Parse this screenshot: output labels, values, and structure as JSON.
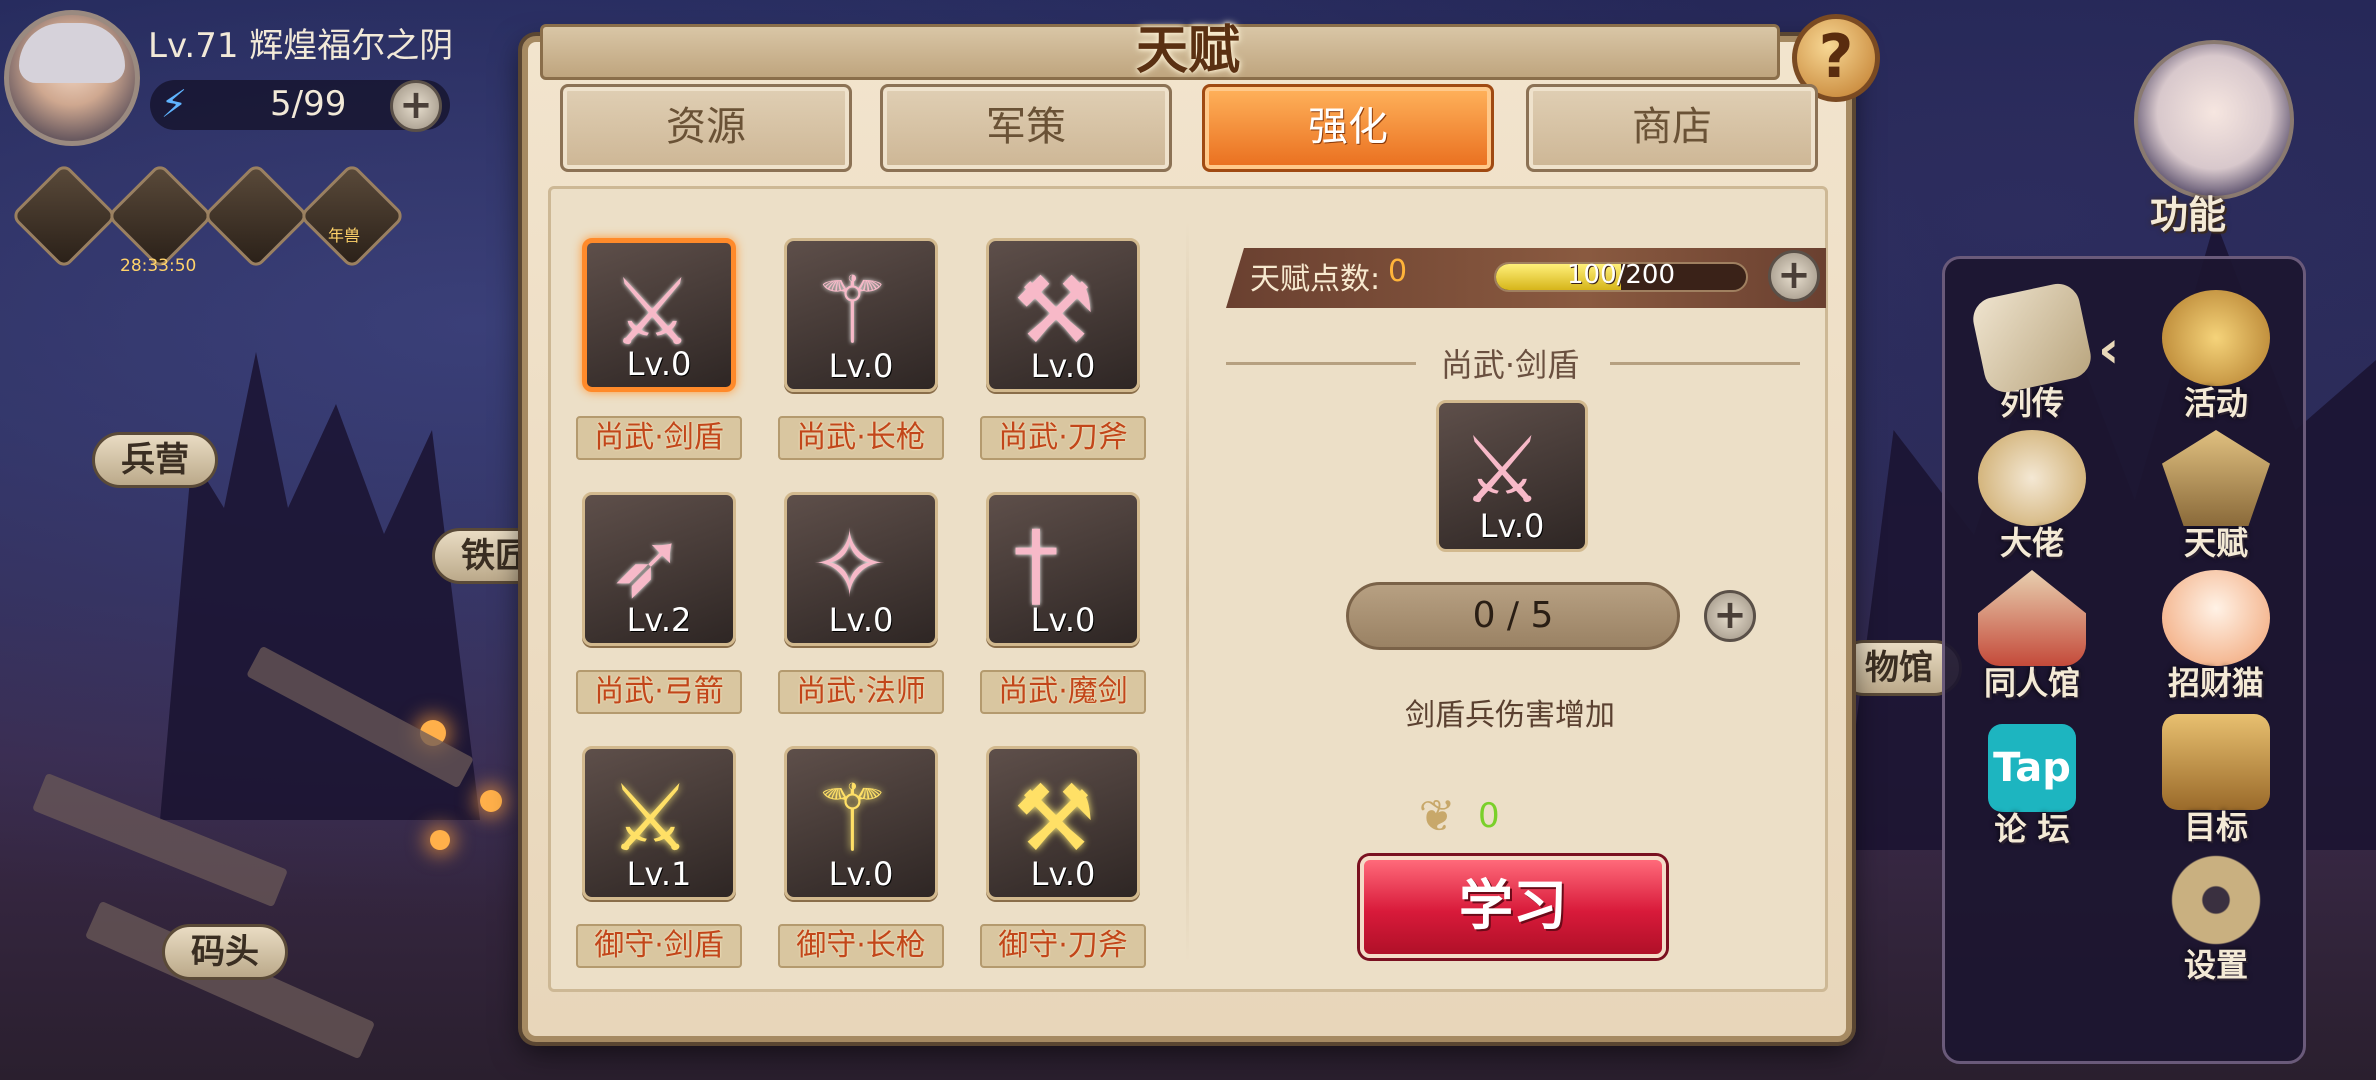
{
  "player": {
    "level_name": "Lv.71  辉煌福尔之阴",
    "energy": "5/99",
    "buff_timer": "28:33:50",
    "buff_label": "年兽"
  },
  "map_labels": {
    "barracks": "兵营",
    "ironworks": "铁匠",
    "dock": "码头",
    "museum": "物馆"
  },
  "side_menu": {
    "title": "功能",
    "items": [
      {
        "label": "列传",
        "icon": "scroll-icon"
      },
      {
        "label": "活动",
        "icon": "star-badge-icon"
      },
      {
        "label": "大佬",
        "icon": "boss-icon"
      },
      {
        "label": "天赋",
        "icon": "talent-icon"
      },
      {
        "label": "同人馆",
        "icon": "gallery-icon"
      },
      {
        "label": "招财猫",
        "icon": "lucky-cat-icon"
      },
      {
        "label": "论 坛",
        "icon": "tap-forum-icon",
        "badge": "Tap"
      },
      {
        "label": "目标",
        "icon": "target-icon"
      },
      {
        "label": "设置",
        "icon": "gear-icon"
      }
    ]
  },
  "modal": {
    "title": "天赋",
    "tabs": [
      "资源",
      "军策",
      "强化",
      "商店"
    ],
    "active_tab": "强化",
    "skills": [
      {
        "name": "尚武·剑盾",
        "level": "Lv.0",
        "glyph": "⚔",
        "selected": true,
        "gold": false
      },
      {
        "name": "尚武·长枪",
        "level": "Lv.0",
        "glyph": "⚚",
        "selected": false,
        "gold": false
      },
      {
        "name": "尚武·刀斧",
        "level": "Lv.0",
        "glyph": "⚒",
        "selected": false,
        "gold": false
      },
      {
        "name": "尚武·弓箭",
        "level": "Lv.2",
        "glyph": "➶",
        "selected": false,
        "gold": false
      },
      {
        "name": "尚武·法师",
        "level": "Lv.0",
        "glyph": "✧",
        "selected": false,
        "gold": false
      },
      {
        "name": "尚武·魔剑",
        "level": "Lv.0",
        "glyph": "†",
        "selected": false,
        "gold": false
      },
      {
        "name": "御守·剑盾",
        "level": "Lv.1",
        "glyph": "⚔",
        "selected": false,
        "gold": true
      },
      {
        "name": "御守·长枪",
        "level": "Lv.0",
        "glyph": "⚚",
        "selected": false,
        "gold": true
      },
      {
        "name": "御守·刀斧",
        "level": "Lv.0",
        "glyph": "⚒",
        "selected": false,
        "gold": true
      }
    ],
    "points_label": "天赋点数:",
    "points_value": "0",
    "progress_current": 100,
    "progress_max": 200,
    "progress_text": "100/200",
    "detail": {
      "title": "尚武·剑盾",
      "level": "Lv.0",
      "count": "0 / 5",
      "description": "剑盾兵伤害增加",
      "cost": "0",
      "learn_label": "学习"
    }
  }
}
